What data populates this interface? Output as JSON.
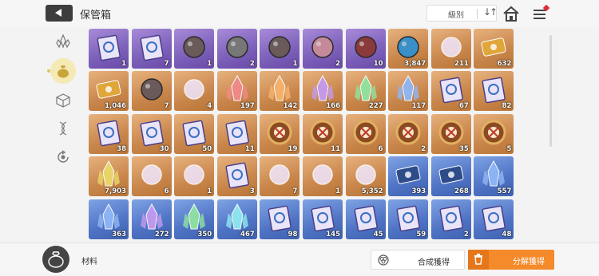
{
  "header": {
    "title": "保管箱",
    "sort_label": "級別",
    "sort_toggle": "↓↑"
  },
  "colors": {
    "orange": "#c9864b",
    "purple": "#7b5fb9",
    "blue": "#4f73c4",
    "accent": "#f48a2a",
    "notify": "#e0293a"
  },
  "sidebar": {
    "tabs": [
      {
        "icon": "crystal-cluster-icon",
        "active": false
      },
      {
        "icon": "material-bag-icon",
        "active": true
      },
      {
        "icon": "cube-icon",
        "active": false
      },
      {
        "icon": "dna-helix-icon",
        "active": false
      },
      {
        "icon": "refresh-cycle-icon",
        "active": false
      }
    ]
  },
  "inventory": {
    "rows": [
      [
        {
          "name": "purple-tablet",
          "rarity": "purple",
          "count": "1"
        },
        {
          "name": "purple-card",
          "rarity": "purple",
          "count": "7"
        },
        {
          "name": "dark-ore",
          "rarity": "purple",
          "count": "1"
        },
        {
          "name": "metal-sphere",
          "rarity": "purple",
          "count": "2"
        },
        {
          "name": "rock-core",
          "rarity": "purple",
          "count": "1"
        },
        {
          "name": "pink-ore",
          "rarity": "purple",
          "count": "2"
        },
        {
          "name": "red-ore",
          "rarity": "purple",
          "count": "10"
        },
        {
          "name": "blue-core",
          "rarity": "orange",
          "count": "3,847"
        },
        {
          "name": "teal-orb",
          "rarity": "orange",
          "count": "211"
        },
        {
          "name": "gold-ticket",
          "rarity": "orange",
          "count": "632"
        }
      ],
      [
        {
          "name": "gold-chip",
          "rarity": "orange",
          "count": "1,046"
        },
        {
          "name": "dark-eye",
          "rarity": "orange",
          "count": "7"
        },
        {
          "name": "gold-crescent",
          "rarity": "orange",
          "count": "4"
        },
        {
          "name": "red-crystal",
          "rarity": "orange",
          "count": "197"
        },
        {
          "name": "orange-crystal",
          "rarity": "orange",
          "count": "142"
        },
        {
          "name": "violet-crystal",
          "rarity": "orange",
          "count": "166"
        },
        {
          "name": "green-crystal",
          "rarity": "orange",
          "count": "227"
        },
        {
          "name": "blue-crystal",
          "rarity": "orange",
          "count": "117"
        },
        {
          "name": "sword-book",
          "rarity": "orange",
          "count": "67"
        },
        {
          "name": "shield-book",
          "rarity": "orange",
          "count": "82"
        }
      ],
      [
        {
          "name": "target-book",
          "rarity": "orange",
          "count": "38"
        },
        {
          "name": "sword-book-2",
          "rarity": "orange",
          "count": "30"
        },
        {
          "name": "x-book",
          "rarity": "orange",
          "count": "50"
        },
        {
          "name": "rune-book",
          "rarity": "orange",
          "count": "11"
        },
        {
          "name": "cross-gear",
          "rarity": "orange",
          "count": "19"
        },
        {
          "name": "shield-gear",
          "rarity": "orange",
          "count": "11"
        },
        {
          "name": "slash-gear",
          "rarity": "orange",
          "count": "6"
        },
        {
          "name": "blade-gear",
          "rarity": "orange",
          "count": "2"
        },
        {
          "name": "arrow-gear",
          "rarity": "orange",
          "count": "35"
        },
        {
          "name": "globe-gear",
          "rarity": "orange",
          "count": "5"
        }
      ],
      [
        {
          "name": "gold-sprout",
          "rarity": "orange",
          "count": "7,903"
        },
        {
          "name": "blue-gem",
          "rarity": "orange",
          "count": "6"
        },
        {
          "name": "white-shoes",
          "rarity": "orange",
          "count": "1"
        },
        {
          "name": "star-book",
          "rarity": "orange",
          "count": "3"
        },
        {
          "name": "spray-gun",
          "rarity": "orange",
          "count": "7"
        },
        {
          "name": "pink-pick",
          "rarity": "orange",
          "count": "1"
        },
        {
          "name": "music-charm",
          "rarity": "orange",
          "count": "5,352"
        },
        {
          "name": "blue-device",
          "rarity": "blue",
          "count": "393"
        },
        {
          "name": "blue-device-2",
          "rarity": "blue",
          "count": "268"
        },
        {
          "name": "blue-shard",
          "rarity": "blue",
          "count": "557"
        }
      ],
      [
        {
          "name": "blue-shard-2",
          "rarity": "blue",
          "count": "363"
        },
        {
          "name": "violet-shard",
          "rarity": "blue",
          "count": "272"
        },
        {
          "name": "green-shard",
          "rarity": "blue",
          "count": "350"
        },
        {
          "name": "cyan-shard",
          "rarity": "blue",
          "count": "467"
        },
        {
          "name": "blue-x-book",
          "rarity": "blue",
          "count": "98"
        },
        {
          "name": "blue-shield-book",
          "rarity": "blue",
          "count": "145"
        },
        {
          "name": "blue-rune-book",
          "rarity": "blue",
          "count": "45"
        },
        {
          "name": "blue-sword-book",
          "rarity": "blue",
          "count": "59"
        },
        {
          "name": "blue-cross-book",
          "rarity": "blue",
          "count": "2"
        },
        {
          "name": "blue-globe-book",
          "rarity": "blue",
          "count": "48"
        }
      ]
    ]
  },
  "footer": {
    "category_label": "材料",
    "synthesize_label": "合成獲得",
    "decompose_label": "分解獲得"
  }
}
